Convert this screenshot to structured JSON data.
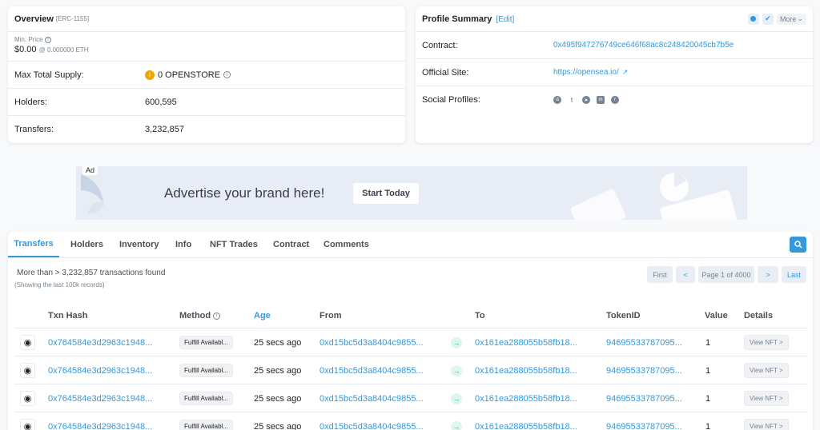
{
  "overview": {
    "title": "Overview",
    "standard": "[ERC-1155]",
    "min_price_label": "Min. Price",
    "min_price_value": "$0.00",
    "min_price_eth": "@ 0.000000 ETH",
    "rows": [
      {
        "label": "Max Total Supply:",
        "value": "0 OPENSTORE"
      },
      {
        "label": "Holders:",
        "value": "600,595"
      },
      {
        "label": "Transfers:",
        "value": "3,232,857"
      }
    ]
  },
  "profile": {
    "title": "Profile Summary",
    "edit": "[Edit]",
    "more": "More",
    "contract_label": "Contract:",
    "contract_value": "0x495f947276749ce646f68ac8c248420045cb7b5e",
    "site_label": "Official Site:",
    "site_value": "https://opensea.io/",
    "social_label": "Social Profiles:",
    "social_icons": [
      "discord-icon",
      "twitter-icon",
      "telegram-icon",
      "medium-icon",
      "reddit-icon"
    ]
  },
  "ad": {
    "badge": "Ad",
    "headline": "Advertise your brand here!",
    "button": "Start Today"
  },
  "tabs": [
    "Transfers",
    "Holders",
    "Inventory",
    "Info",
    "NFT Trades",
    "Contract",
    "Comments"
  ],
  "results": {
    "summary": "More than > 3,232,857 transactions found",
    "note": "(Showing the last 100k records)"
  },
  "pagination": {
    "first": "First",
    "prev": "<",
    "page": "Page 1 of 4000",
    "next": ">",
    "last": "Last"
  },
  "table": {
    "headers": {
      "hash": "Txn Hash",
      "method": "Method",
      "age": "Age",
      "from": "From",
      "to": "To",
      "token": "TokenID",
      "value": "Value",
      "details": "Details"
    },
    "rows": [
      {
        "hash": "0x764584e3d2963c1948...",
        "method": "Fulfill Availabl...",
        "age": "25 secs ago",
        "from": "0xd15bc5d3a8404c9855...",
        "to": "0x161ea288055b58fb18...",
        "token": "94695533787095...",
        "value": "1",
        "details": "View NFT >"
      },
      {
        "hash": "0x764584e3d2963c1948...",
        "method": "Fulfill Availabl...",
        "age": "25 secs ago",
        "from": "0xd15bc5d3a8404c9855...",
        "to": "0x161ea288055b58fb18...",
        "token": "94695533787095...",
        "value": "1",
        "details": "View NFT >"
      },
      {
        "hash": "0x764584e3d2963c1948...",
        "method": "Fulfill Availabl...",
        "age": "25 secs ago",
        "from": "0xd15bc5d3a8404c9855...",
        "to": "0x161ea288055b58fb18...",
        "token": "94695533787095...",
        "value": "1",
        "details": "View NFT >"
      },
      {
        "hash": "0x764584e3d2963c1948...",
        "method": "Fulfill Availabl...",
        "age": "25 secs ago",
        "from": "0xd15bc5d3a8404c9855...",
        "to": "0x161ea288055b58fb18...",
        "token": "94695533787095...",
        "value": "1",
        "details": "View NFT >"
      }
    ]
  },
  "colors": {
    "accent": "#3498db",
    "success": "#00c9a7",
    "warning": "#f0a500"
  }
}
